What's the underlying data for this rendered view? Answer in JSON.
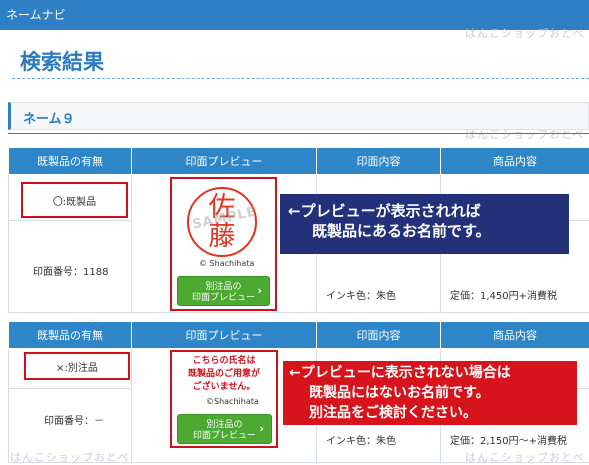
{
  "header": {
    "title": "ネームナビ"
  },
  "watermark": "はんこショップおとべ",
  "page": {
    "title": "検索結果"
  },
  "section": {
    "title": "ネーム９"
  },
  "table_headers": [
    "既製品の有無",
    "印面プレビュー",
    "印面内容",
    "商品内容"
  ],
  "rows": [
    {
      "availability": "〇:既製品",
      "seal_number": "印面番号：1188",
      "stamp_chars": [
        "佐",
        "藤"
      ],
      "stamp_watermark": "SAMPLE",
      "brand": "© Shachihata",
      "button_label_line1": "別注品の",
      "button_label_line2": "印面プレビュー",
      "ink_color": "インキ色：朱色",
      "price": "定価：1,450円+消費税",
      "callout_lines": [
        "←プレビューが表示されれば",
        "既製品にあるお名前です。"
      ]
    },
    {
      "availability": "×:別注品",
      "seal_number": "印面番号：－",
      "not_stock_lines": [
        "こちらの氏名は",
        "既製品のご用意が",
        "ございません。"
      ],
      "brand": "©Shachihata",
      "button_label_line1": "別注品の",
      "button_label_line2": "印面プレビュー",
      "ink_color": "インキ色：朱色",
      "price": "定価：2,150円〜+消費税",
      "callout_lines": [
        "←プレビューに表示されない場合は",
        "既製品にはないお名前です。",
        "別注品をご検討ください。"
      ]
    }
  ],
  "colors": {
    "header_bar": "#2e7fc4",
    "table_header": "#2e86c8",
    "highlight_border": "#d0101a",
    "callout_blue": "#22317a",
    "callout_red": "#d7131b",
    "button_green": "#4ca932"
  },
  "icons": {
    "button_arrow": "chevron-right-icon"
  }
}
